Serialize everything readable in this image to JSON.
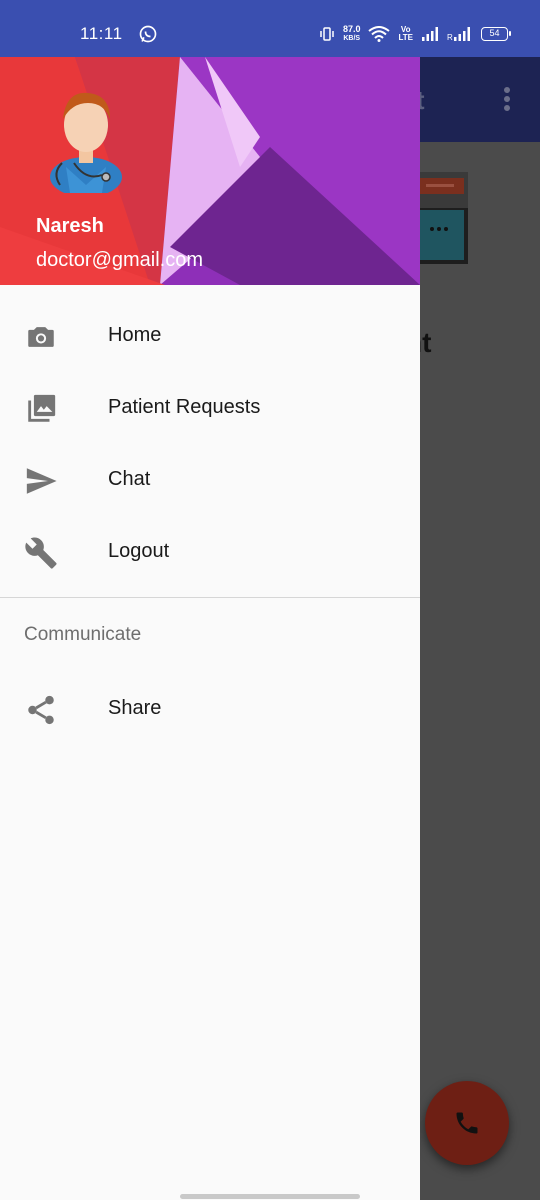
{
  "status_bar": {
    "time": "11:11",
    "speed_value": "87.0",
    "speed_unit": "KB/S",
    "volte_top": "Vo",
    "volte_bottom": "LTE",
    "battery": "54"
  },
  "background_app": {
    "toolbar_title_fragment": "nt",
    "heading_fragment": "nt"
  },
  "drawer": {
    "user_name": "Naresh",
    "user_email": "doctor@gmail.com",
    "items": [
      {
        "label": "Home",
        "icon": "camera-icon"
      },
      {
        "label": "Patient Requests",
        "icon": "gallery-icon"
      },
      {
        "label": "Chat",
        "icon": "send-icon"
      },
      {
        "label": "Logout",
        "icon": "wrench-icon"
      }
    ],
    "section_title": "Communicate",
    "section_items": [
      {
        "label": "Share",
        "icon": "share-icon"
      }
    ]
  },
  "colors": {
    "status_bar": "#3a4fb0",
    "toolbar": "#1d2353",
    "fab": "#6e1f14",
    "icon_gray": "#757575"
  }
}
